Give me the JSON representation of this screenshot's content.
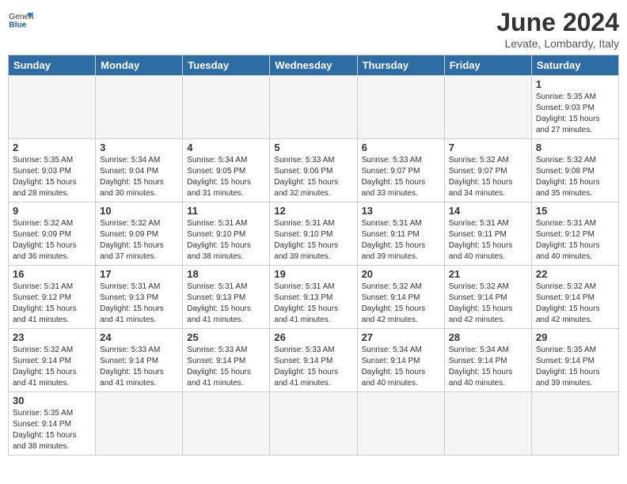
{
  "header": {
    "logo_general": "General",
    "logo_blue": "Blue",
    "month_title": "June 2024",
    "subtitle": "Levate, Lombardy, Italy"
  },
  "weekdays": [
    "Sunday",
    "Monday",
    "Tuesday",
    "Wednesday",
    "Thursday",
    "Friday",
    "Saturday"
  ],
  "weeks": [
    [
      {
        "day": "",
        "info": ""
      },
      {
        "day": "",
        "info": ""
      },
      {
        "day": "",
        "info": ""
      },
      {
        "day": "",
        "info": ""
      },
      {
        "day": "",
        "info": ""
      },
      {
        "day": "",
        "info": ""
      },
      {
        "day": "1",
        "info": "Sunrise: 5:35 AM\nSunset: 9:03 PM\nDaylight: 15 hours and 27 minutes."
      }
    ],
    [
      {
        "day": "2",
        "info": "Sunrise: 5:35 AM\nSunset: 9:03 PM\nDaylight: 15 hours and 28 minutes."
      },
      {
        "day": "3",
        "info": "Sunrise: 5:34 AM\nSunset: 9:04 PM\nDaylight: 15 hours and 30 minutes."
      },
      {
        "day": "4",
        "info": "Sunrise: 5:34 AM\nSunset: 9:05 PM\nDaylight: 15 hours and 31 minutes."
      },
      {
        "day": "5",
        "info": "Sunrise: 5:33 AM\nSunset: 9:06 PM\nDaylight: 15 hours and 32 minutes."
      },
      {
        "day": "6",
        "info": "Sunrise: 5:33 AM\nSunset: 9:07 PM\nDaylight: 15 hours and 33 minutes."
      },
      {
        "day": "7",
        "info": "Sunrise: 5:32 AM\nSunset: 9:07 PM\nDaylight: 15 hours and 34 minutes."
      },
      {
        "day": "8",
        "info": "Sunrise: 5:32 AM\nSunset: 9:08 PM\nDaylight: 15 hours and 35 minutes."
      }
    ],
    [
      {
        "day": "9",
        "info": "Sunrise: 5:32 AM\nSunset: 9:09 PM\nDaylight: 15 hours and 36 minutes."
      },
      {
        "day": "10",
        "info": "Sunrise: 5:32 AM\nSunset: 9:09 PM\nDaylight: 15 hours and 37 minutes."
      },
      {
        "day": "11",
        "info": "Sunrise: 5:31 AM\nSunset: 9:10 PM\nDaylight: 15 hours and 38 minutes."
      },
      {
        "day": "12",
        "info": "Sunrise: 5:31 AM\nSunset: 9:10 PM\nDaylight: 15 hours and 39 minutes."
      },
      {
        "day": "13",
        "info": "Sunrise: 5:31 AM\nSunset: 9:11 PM\nDaylight: 15 hours and 39 minutes."
      },
      {
        "day": "14",
        "info": "Sunrise: 5:31 AM\nSunset: 9:11 PM\nDaylight: 15 hours and 40 minutes."
      },
      {
        "day": "15",
        "info": "Sunrise: 5:31 AM\nSunset: 9:12 PM\nDaylight: 15 hours and 40 minutes."
      }
    ],
    [
      {
        "day": "16",
        "info": "Sunrise: 5:31 AM\nSunset: 9:12 PM\nDaylight: 15 hours and 41 minutes."
      },
      {
        "day": "17",
        "info": "Sunrise: 5:31 AM\nSunset: 9:13 PM\nDaylight: 15 hours and 41 minutes."
      },
      {
        "day": "18",
        "info": "Sunrise: 5:31 AM\nSunset: 9:13 PM\nDaylight: 15 hours and 41 minutes."
      },
      {
        "day": "19",
        "info": "Sunrise: 5:31 AM\nSunset: 9:13 PM\nDaylight: 15 hours and 41 minutes."
      },
      {
        "day": "20",
        "info": "Sunrise: 5:32 AM\nSunset: 9:14 PM\nDaylight: 15 hours and 42 minutes."
      },
      {
        "day": "21",
        "info": "Sunrise: 5:32 AM\nSunset: 9:14 PM\nDaylight: 15 hours and 42 minutes."
      },
      {
        "day": "22",
        "info": "Sunrise: 5:32 AM\nSunset: 9:14 PM\nDaylight: 15 hours and 42 minutes."
      }
    ],
    [
      {
        "day": "23",
        "info": "Sunrise: 5:32 AM\nSunset: 9:14 PM\nDaylight: 15 hours and 41 minutes."
      },
      {
        "day": "24",
        "info": "Sunrise: 5:33 AM\nSunset: 9:14 PM\nDaylight: 15 hours and 41 minutes."
      },
      {
        "day": "25",
        "info": "Sunrise: 5:33 AM\nSunset: 9:14 PM\nDaylight: 15 hours and 41 minutes."
      },
      {
        "day": "26",
        "info": "Sunrise: 5:33 AM\nSunset: 9:14 PM\nDaylight: 15 hours and 41 minutes."
      },
      {
        "day": "27",
        "info": "Sunrise: 5:34 AM\nSunset: 9:14 PM\nDaylight: 15 hours and 40 minutes."
      },
      {
        "day": "28",
        "info": "Sunrise: 5:34 AM\nSunset: 9:14 PM\nDaylight: 15 hours and 40 minutes."
      },
      {
        "day": "29",
        "info": "Sunrise: 5:35 AM\nSunset: 9:14 PM\nDaylight: 15 hours and 39 minutes."
      }
    ],
    [
      {
        "day": "30",
        "info": "Sunrise: 5:35 AM\nSunset: 9:14 PM\nDaylight: 15 hours and 38 minutes."
      },
      {
        "day": "",
        "info": ""
      },
      {
        "day": "",
        "info": ""
      },
      {
        "day": "",
        "info": ""
      },
      {
        "day": "",
        "info": ""
      },
      {
        "day": "",
        "info": ""
      },
      {
        "day": "",
        "info": ""
      }
    ]
  ]
}
